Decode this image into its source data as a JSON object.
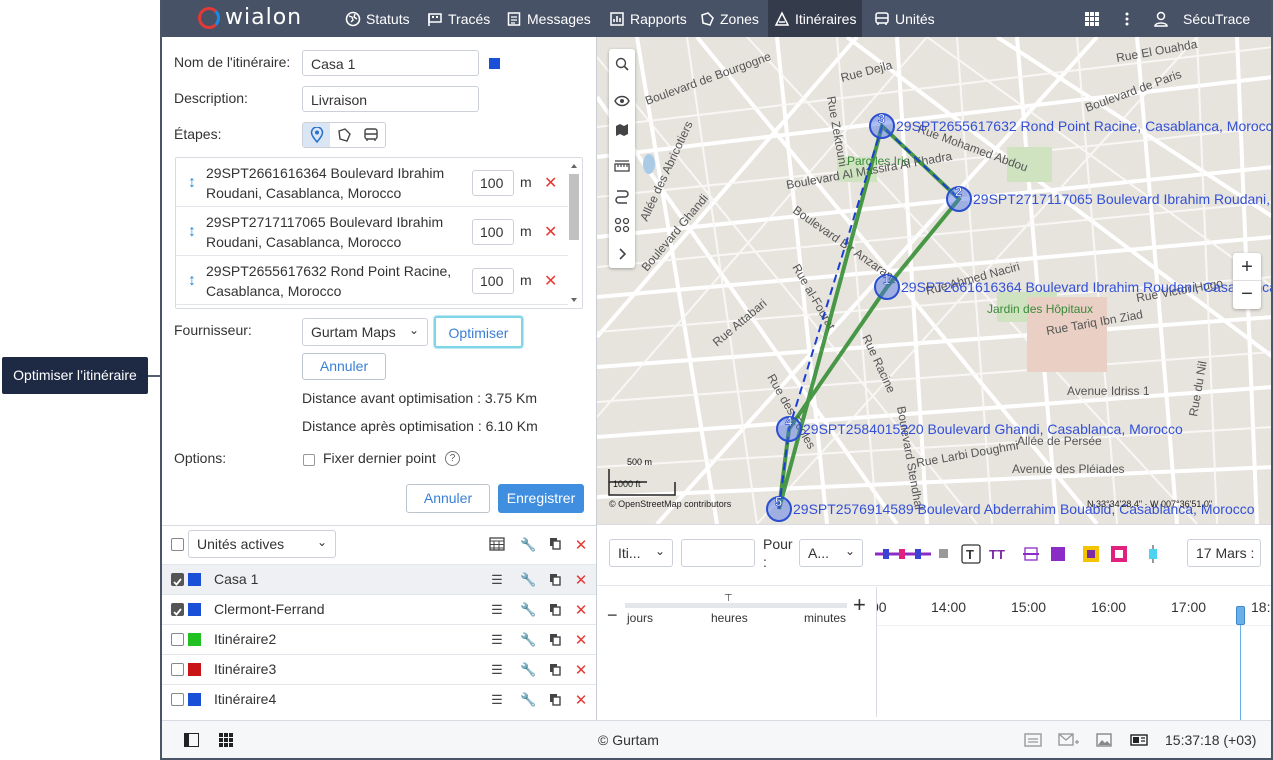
{
  "app": {
    "logo": "wialon",
    "account": "SécuTrace"
  },
  "nav": [
    {
      "label": "Statuts",
      "icon": "globe-icon"
    },
    {
      "label": "Tracés",
      "icon": "flag-icon"
    },
    {
      "label": "Messages",
      "icon": "document-icon"
    },
    {
      "label": "Rapports",
      "icon": "chart-icon"
    },
    {
      "label": "Zones",
      "icon": "polygon-icon"
    },
    {
      "label": "Itinéraires",
      "icon": "route-icon"
    },
    {
      "label": "Unités",
      "icon": "bus-icon"
    }
  ],
  "form": {
    "name_label": "Nom de l'itinéraire:",
    "name_value": "Casa 1",
    "name_color": "#1a4fd8",
    "desc_label": "Description:",
    "desc_value": "Livraison",
    "stages_label": "Étapes:",
    "provider_label": "Fournisseur:",
    "provider_value": "Gurtam Maps",
    "optimize_label": "Optimiser",
    "cancel_opt_label": "Annuler",
    "dist_before": "Distance avant optimisation : 3.75 Km",
    "dist_after": "Distance après optimisation : 6.10 Km",
    "options_label": "Options:",
    "fix_last_label": "Fixer dernier point",
    "cancel_label": "Annuler",
    "save_label": "Enregistrer"
  },
  "stages": [
    {
      "line1": "29SPT2661616364 Boulevard Ibrahim",
      "line2": "Roudani, Casablanca, Morocco",
      "radius": "100",
      "unit": "m"
    },
    {
      "line1": "29SPT2717117065 Boulevard Ibrahim",
      "line2": "Roudani, Casablanca, Morocco",
      "radius": "100",
      "unit": "m"
    },
    {
      "line1": "29SPT2655617632 Rond Point Racine,",
      "line2": "Casablanca, Morocco",
      "radius": "100",
      "unit": "m"
    }
  ],
  "units_panel": {
    "filter": "Unités actives",
    "rows": [
      {
        "name": "Casa 1",
        "color": "#1a4fd8",
        "checked": true
      },
      {
        "name": "Clermont-Ferrand",
        "color": "#1a4fd8",
        "checked": true
      },
      {
        "name": "Itinéraire2",
        "color": "#22c122",
        "checked": false
      },
      {
        "name": "Itinéraire3",
        "color": "#c81414",
        "checked": false
      },
      {
        "name": "Itinéraire4",
        "color": "#1a4fd8",
        "checked": false
      }
    ]
  },
  "map": {
    "points": [
      {
        "n": "1",
        "label": "29SPT2661616364 Boulevard Ibrahim Roudani, Casablanca, Mor"
      },
      {
        "n": "2",
        "label": "29SPT2717117065 Boulevard Ibrahim Roudani, C"
      },
      {
        "n": "3",
        "label": "29SPT2655617632 Rond Point Racine, Casablanca, Morocco"
      },
      {
        "n": "4",
        "label": "29SPT2584015220 Boulevard Ghandi, Casablanca, Morocco"
      },
      {
        "n": "5",
        "label": "29SPT2576914589 Boulevard Abderrahim Bouabid, Casablanca, Morocco"
      }
    ],
    "scale_m": "500 m",
    "scale_ft": "1000 ft",
    "attribution": "© OpenStreetMap contributors",
    "coords": "N 33°34'28.4\" · W 007°36'51.0\"",
    "streets": [
      "Boulevard de Bourgogne",
      "Rue Dejla",
      "Boulevard de Paris",
      "Rue Zektouni",
      "Rue Mohamed Abdou",
      "Rue El Ouahda",
      "Parc les Iris",
      "Boulevard Al Massira Al Khadra",
      "Allée des Abricotiers",
      "Boulevard Bir Anzarane",
      "Rue al-Fourat",
      "Boulevard Ghandi",
      "Rue Attabari",
      "Rue Ahmed Naciri",
      "Jardin des Hôpitaux",
      "Rue Tariq Ibn Ziad",
      "Rue Victor Hugo",
      "Avenue Idriss 1",
      "Allée de Persée",
      "Avenue des Pléiades",
      "Rue Racine",
      "Boulevard Stendhal",
      "Rue Larbi Doughmi",
      "Rue des Ecoles",
      "Rue du Nil"
    ]
  },
  "timeline": {
    "route_select": "Iti...",
    "for_label": "Pour :",
    "for_select": "A...",
    "date": "17 Mars :",
    "zoom_labels": [
      "jours",
      "heures",
      "minutes"
    ],
    "hours": [
      "00",
      "14:00",
      "15:00",
      "16:00",
      "17:00",
      "18:"
    ]
  },
  "footer": {
    "copyright": "© Gurtam",
    "time": "15:37:18 (+03)"
  },
  "callout": "Optimiser l’itinéraire"
}
